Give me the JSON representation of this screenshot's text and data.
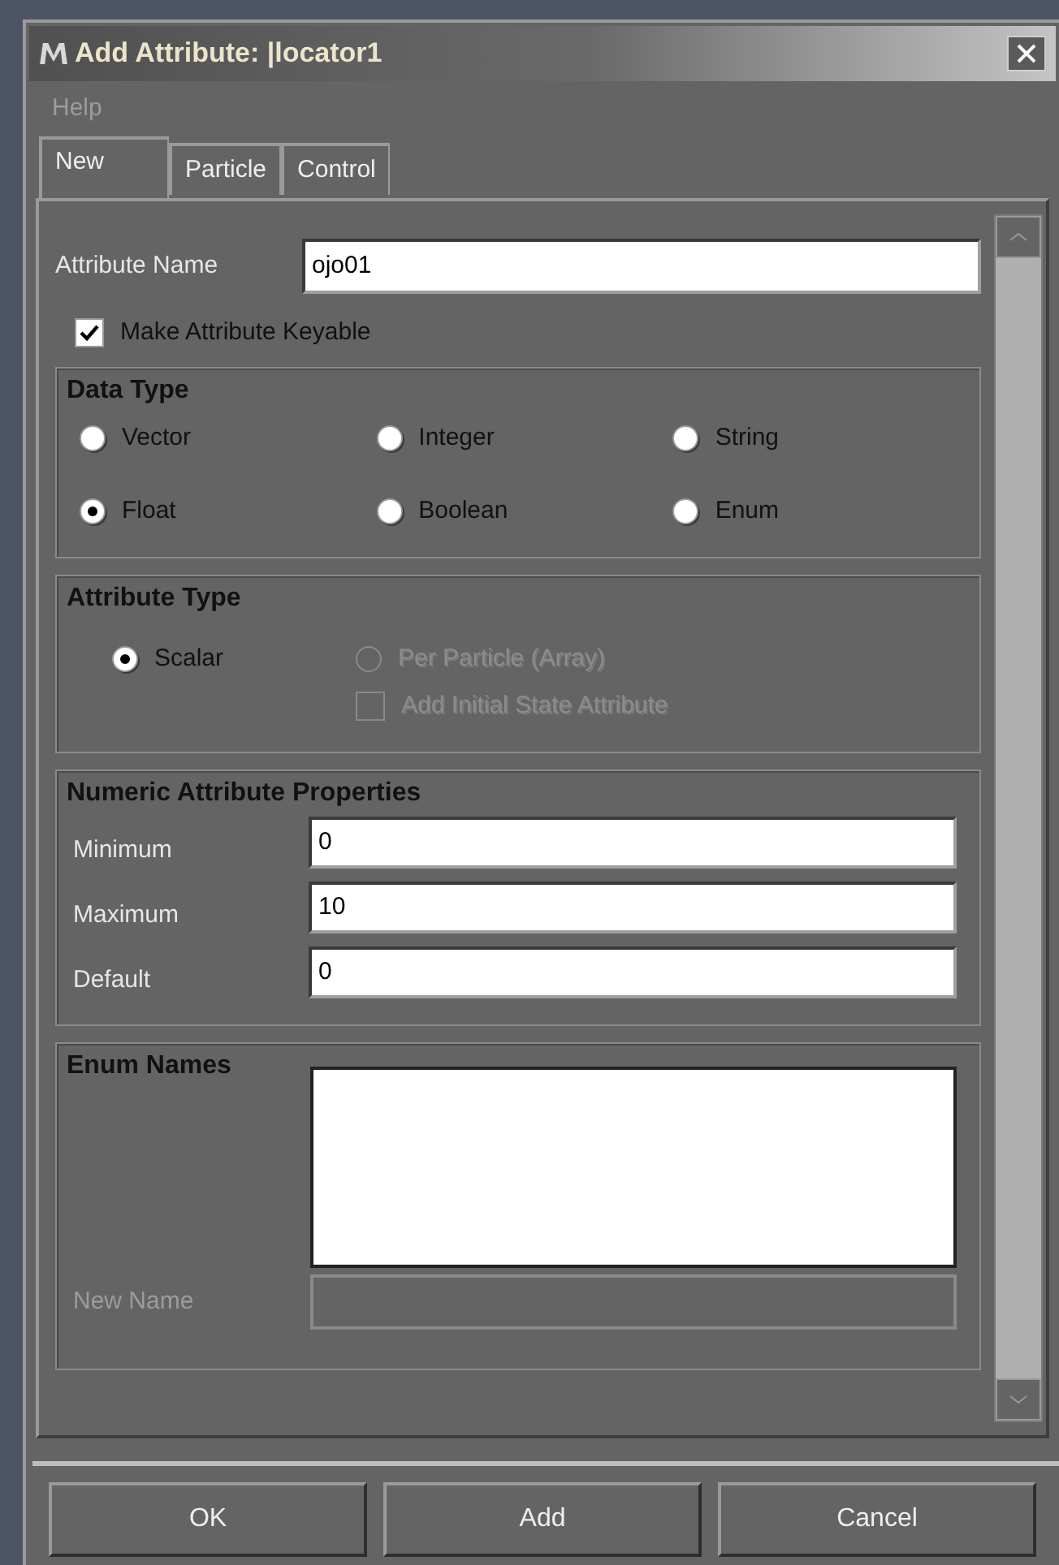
{
  "window": {
    "title": "Add Attribute: |locator1"
  },
  "menu": [
    {
      "label": "Help",
      "disabled": true
    }
  ],
  "tabs": [
    {
      "label": "New",
      "selected": true
    },
    {
      "label": "Particle",
      "selected": false
    },
    {
      "label": "Control",
      "selected": false
    }
  ],
  "attribute_name": {
    "label": "Attribute Name",
    "value": "ojo01"
  },
  "keyable": {
    "label": "Make Attribute Keyable",
    "checked": true
  },
  "data_type": {
    "title": "Data Type",
    "options": [
      {
        "label": "Vector",
        "selected": false
      },
      {
        "label": "Integer",
        "selected": false
      },
      {
        "label": "String",
        "selected": false
      },
      {
        "label": "Float",
        "selected": true
      },
      {
        "label": "Boolean",
        "selected": false
      },
      {
        "label": "Enum",
        "selected": false
      }
    ]
  },
  "attribute_type": {
    "title": "Attribute Type",
    "options": [
      {
        "kind": "radio",
        "label": "Scalar",
        "selected": true,
        "disabled": false
      },
      {
        "kind": "radio",
        "label": "Per Particle (Array)",
        "selected": false,
        "disabled": true
      },
      {
        "kind": "checkbox",
        "label": "Add Initial State Attribute",
        "checked": false,
        "disabled": true
      }
    ]
  },
  "numeric": {
    "title": "Numeric Attribute Properties",
    "fields": [
      {
        "label": "Minimum",
        "value": "0"
      },
      {
        "label": "Maximum",
        "value": "10"
      },
      {
        "label": "Default",
        "value": "0"
      }
    ]
  },
  "enum_names": {
    "title": "Enum Names",
    "new_name": {
      "label": "New Name",
      "disabled": true
    }
  },
  "buttons": [
    "OK",
    "Add",
    "Cancel"
  ]
}
